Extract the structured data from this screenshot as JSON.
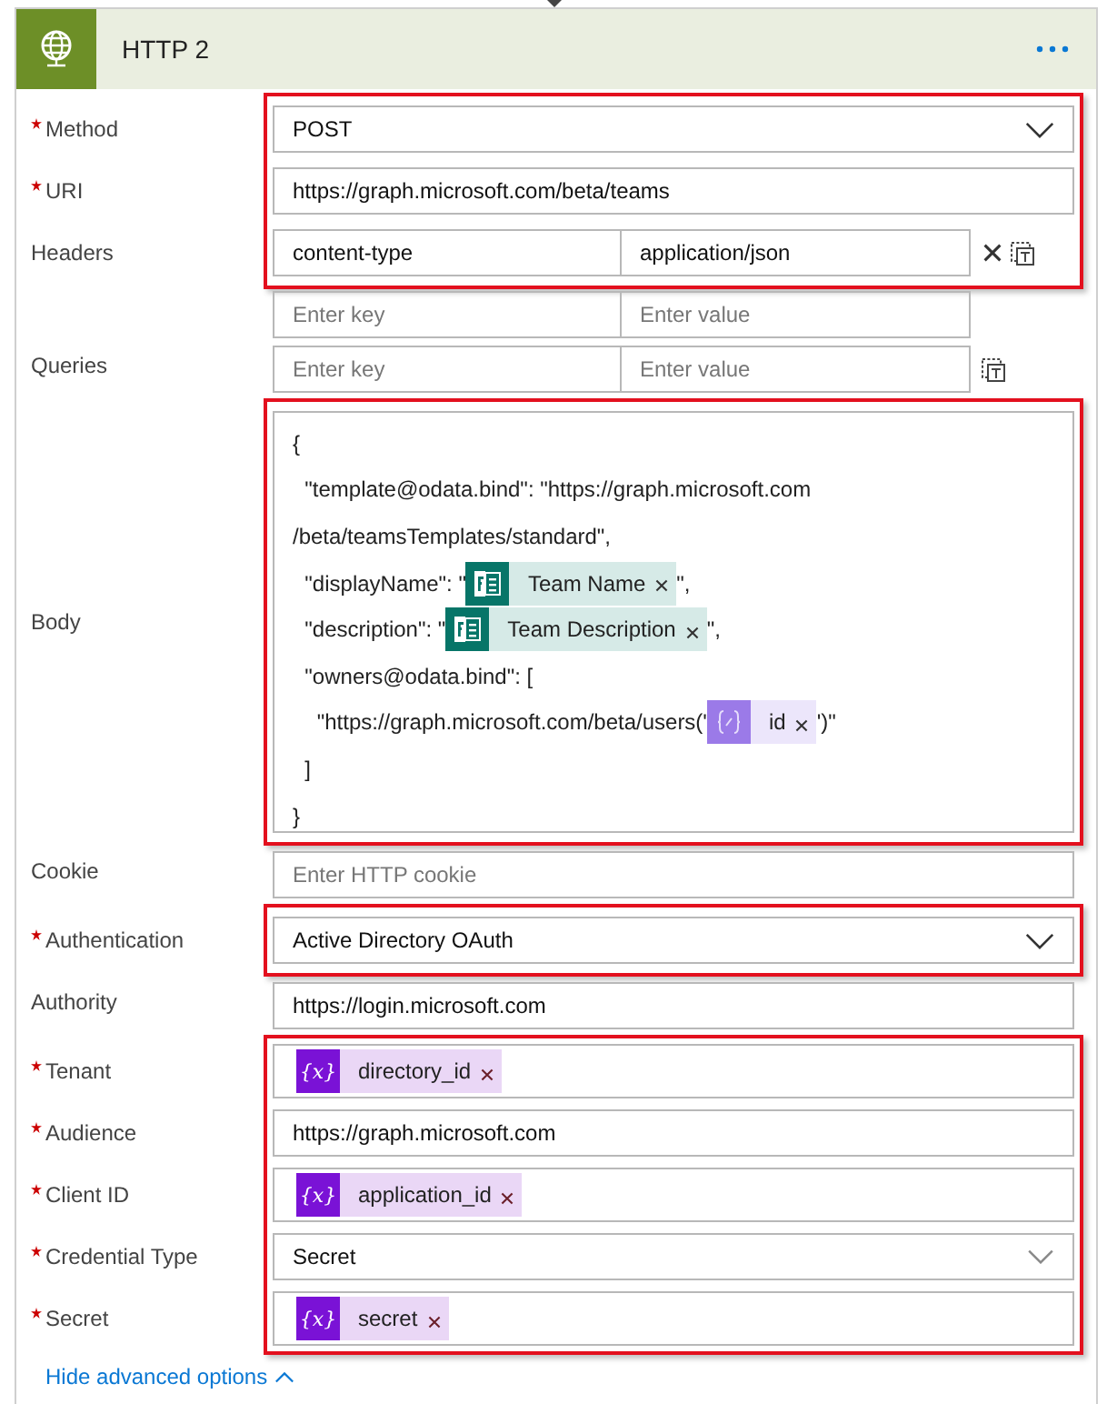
{
  "header": {
    "title": "HTTP 2"
  },
  "blocks": [
    {
      "highlighted": true,
      "rows": [
        {
          "kind": "dropdown",
          "label": "Method",
          "required": true,
          "value": "POST"
        },
        {
          "kind": "text",
          "label": "URI",
          "required": true,
          "value": "https://graph.microsoft.com/beta/teams"
        },
        {
          "kind": "keyvalue",
          "label": "Headers",
          "required": false,
          "key": "content-type",
          "value": "application/json",
          "removable": true,
          "copyable": true
        }
      ]
    },
    {
      "highlighted": false,
      "rows": [
        {
          "kind": "keyvalue",
          "continuation": true,
          "key_placeholder": "Enter key",
          "value_placeholder": "Enter value",
          "removable": false,
          "copyable": false
        },
        {
          "kind": "keyvalue",
          "label": "Queries",
          "required": false,
          "key_placeholder": "Enter key",
          "value_placeholder": "Enter value",
          "removable": false,
          "copyable": true
        }
      ]
    },
    {
      "highlighted": true,
      "rows": [
        {
          "kind": "body",
          "label": "Body",
          "required": false,
          "lines": [
            [
              {
                "kind": "text",
                "text": "{"
              }
            ],
            [
              {
                "kind": "text",
                "text": "  \"template@odata.bind\": \"https://graph.microsoft.com"
              }
            ],
            [
              {
                "kind": "text",
                "text": "/beta/teamsTemplates/standard\","
              }
            ],
            [
              {
                "kind": "text",
                "text": "  \"displayName\": \""
              },
              {
                "kind": "forms",
                "label": "Team Name"
              },
              {
                "kind": "text",
                "text": "\","
              }
            ],
            [
              {
                "kind": "text",
                "text": "  \"description\": \""
              },
              {
                "kind": "forms",
                "label": "Team Description"
              },
              {
                "kind": "text",
                "text": "\","
              }
            ],
            [
              {
                "kind": "text",
                "text": "  \"owners@odata.bind\": ["
              }
            ],
            [
              {
                "kind": "text",
                "text": "    \"https://graph.microsoft.com/beta/users('"
              },
              {
                "kind": "expression",
                "label": "id"
              },
              {
                "kind": "text",
                "text": "')\""
              }
            ],
            [
              {
                "kind": "text",
                "text": "  ]"
              }
            ],
            [
              {
                "kind": "text",
                "text": "}"
              }
            ]
          ]
        }
      ]
    },
    {
      "highlighted": false,
      "rows": [
        {
          "kind": "text",
          "label": "Cookie",
          "required": false,
          "placeholder": "Enter HTTP cookie"
        }
      ]
    },
    {
      "highlighted": true,
      "rows": [
        {
          "kind": "dropdown",
          "label": "Authentication",
          "required": true,
          "value": "Active Directory OAuth"
        }
      ]
    },
    {
      "highlighted": false,
      "rows": [
        {
          "kind": "text",
          "label": "Authority",
          "required": false,
          "value": "https://login.microsoft.com"
        }
      ]
    },
    {
      "highlighted": true,
      "rows": [
        {
          "kind": "token",
          "label": "Tenant",
          "required": true,
          "token": {
            "icon": "{x}",
            "label": "directory_id"
          }
        },
        {
          "kind": "text",
          "label": "Audience",
          "required": true,
          "value": "https://graph.microsoft.com"
        },
        {
          "kind": "token",
          "label": "Client ID",
          "required": true,
          "token": {
            "icon": "{x}",
            "label": "application_id"
          }
        },
        {
          "kind": "dropdown",
          "label": "Credential Type",
          "required": true,
          "value": "Secret",
          "subtle": true
        },
        {
          "kind": "token",
          "label": "Secret",
          "required": true,
          "token": {
            "icon": "{x}",
            "label": "secret"
          }
        }
      ]
    }
  ],
  "footer": {
    "link": "Hide advanced options"
  }
}
